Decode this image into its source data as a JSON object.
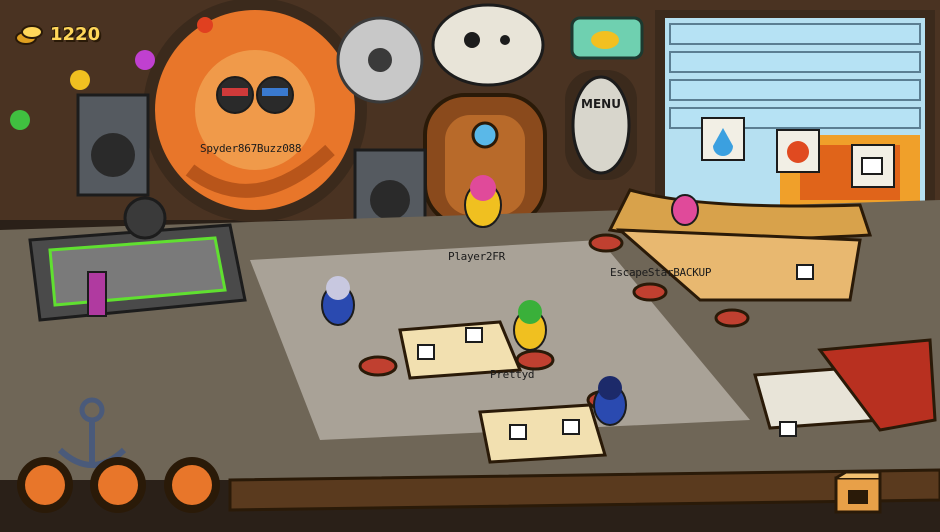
{
  "hud": {
    "coins": "1220",
    "coin_icon": "coin-stack-icon"
  },
  "room": {
    "menu_board": "MENU",
    "players": [
      {
        "name": "Spyder867",
        "tag": "Spyder867Buzz088"
      },
      {
        "name": "Player2",
        "tag": "Player2FR"
      },
      {
        "name": "EscapeStarBACKUP",
        "tag": "EscapeStarBACKUP"
      },
      {
        "name": "Pretty",
        "tag": "Prettyd"
      }
    ]
  },
  "colors": {
    "floor": "#6f6657",
    "wall": "#6b4a2a",
    "gear": "#e8762a",
    "counter": "#d8a24b",
    "accent": "#ffd75a"
  },
  "buttons": {
    "catalog": "catalog-box-icon"
  }
}
